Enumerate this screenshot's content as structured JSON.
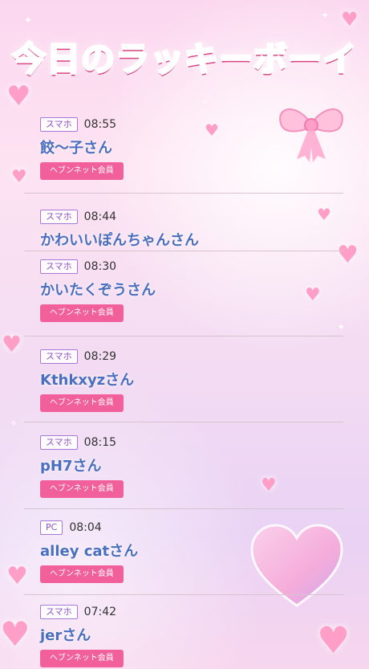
{
  "header": {
    "title": "今日のラッキーボーイ"
  },
  "badge_label": "ヘブンネット会員",
  "colors": {
    "accent": "#f2609b",
    "name": "#4a6fbf",
    "device_border": "#a878d8"
  },
  "entries": [
    {
      "device": "スマホ",
      "time": "08:55",
      "name": "餃〜子さん",
      "member": true
    },
    {
      "device": "スマホ",
      "time": "08:44",
      "name": "かわいいぽんちゃんさん",
      "member": false
    },
    {
      "device": "スマホ",
      "time": "08:30",
      "name": "かいたくぞうさん",
      "member": true
    },
    {
      "device": "スマホ",
      "time": "08:29",
      "name": "Kthkxyzさん",
      "member": true
    },
    {
      "device": "スマホ",
      "time": "08:15",
      "name": "pH7さん",
      "member": true
    },
    {
      "device": "PC",
      "time": "08:04",
      "name": "alley catさん",
      "member": true
    },
    {
      "device": "スマホ",
      "time": "07:42",
      "name": "jerさん",
      "member": true
    }
  ]
}
